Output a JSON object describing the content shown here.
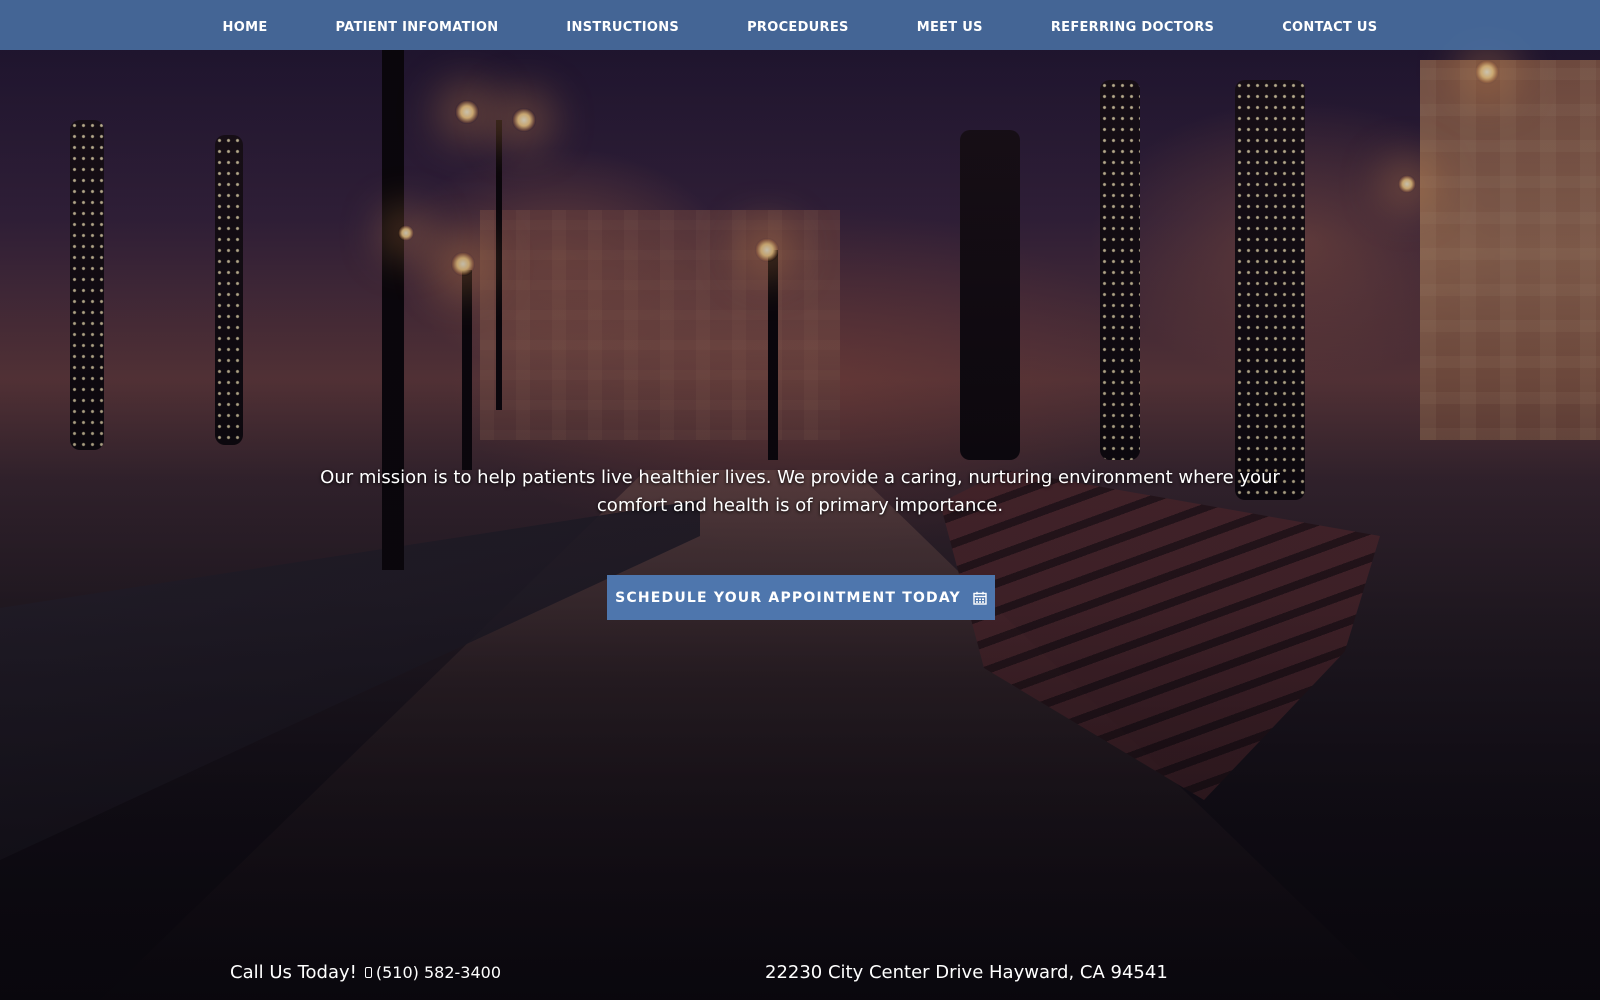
{
  "nav": {
    "items": [
      {
        "label": "HOME"
      },
      {
        "label": "PATIENT INFOMATION"
      },
      {
        "label": "INSTRUCTIONS"
      },
      {
        "label": "PROCEDURES"
      },
      {
        "label": "MEET US"
      },
      {
        "label": "REFERRING DOCTORS"
      },
      {
        "label": "CONTACT US"
      }
    ]
  },
  "hero": {
    "mission_text": "Our mission is to help patients live healthier lives. We provide a caring, nurturing environment where your comfort and health is of primary importance.",
    "cta_label": "SCHEDULE YOUR APPOINTMENT TODAY",
    "cta_icon": "calendar-icon"
  },
  "footer": {
    "call_label": "Call Us Today!",
    "phone_icon": "mobile-phone-icon",
    "phone": "(510) 582-3400",
    "address": "22230 City Center Drive Hayward, CA 94541"
  },
  "colors": {
    "nav_background": "#486c9e",
    "cta_background": "#4e76ad",
    "text": "#ffffff"
  }
}
